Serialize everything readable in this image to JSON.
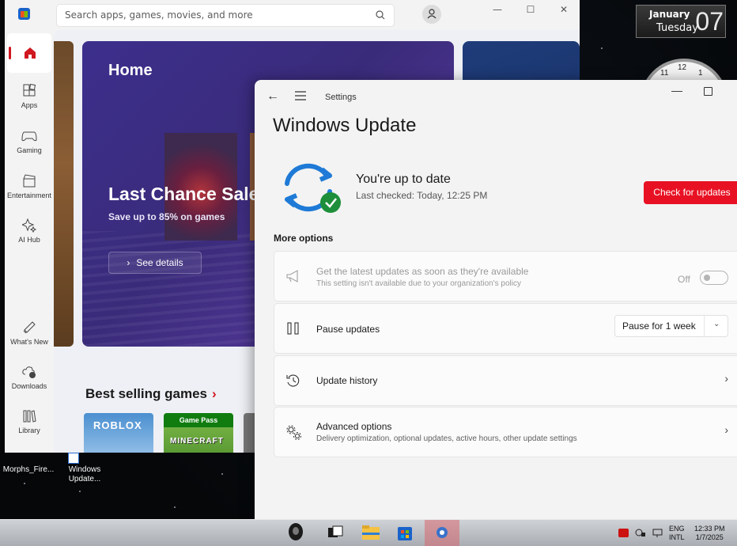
{
  "store": {
    "search_placeholder": "Search apps, games, movies, and more",
    "rail": [
      {
        "label": ""
      },
      {
        "label": "Apps"
      },
      {
        "label": "Gaming"
      },
      {
        "label": "Entertainment"
      },
      {
        "label": "AI Hub"
      },
      {
        "label": "What's New"
      },
      {
        "label": "Downloads"
      },
      {
        "label": "Library"
      }
    ],
    "hero": {
      "title": "Home",
      "headline": "Last Chance Sale",
      "subtitle": "Save up to 85% on games",
      "button": "See details"
    },
    "best_selling": "Best selling games",
    "tiles": [
      {
        "title": "ROBLOX"
      },
      {
        "badge": "Game Pass",
        "title": "MINECRAFT"
      }
    ]
  },
  "settings": {
    "app_title": "Settings",
    "page_title": "Windows Update",
    "status_title": "You're up to date",
    "status_sub": "Last checked: Today, 12:25 PM",
    "check_button": "Check for updates",
    "more_options": "More options",
    "options": [
      {
        "label": "Get the latest updates as soon as they're available",
        "desc": "This setting isn't available due to your organization's policy",
        "toggle_text": "Off",
        "toggle_on": false,
        "disabled": true
      },
      {
        "label": "Pause updates",
        "select_value": "Pause for 1 week"
      },
      {
        "label": "Update history"
      },
      {
        "label": "Advanced options",
        "desc": "Delivery optimization, optional updates, active hours, other update settings"
      }
    ],
    "accent_color": "#e81123"
  },
  "desktop": {
    "date_month": "January",
    "date_weekday": "Tuesday",
    "date_day": "07",
    "clock_numbers": [
      "11",
      "12",
      "1"
    ],
    "icons": [
      {
        "label": "Morphs_Fire..."
      },
      {
        "label": "Windows Update..."
      }
    ]
  },
  "taskbar": {
    "lang_top": "ENG",
    "lang_bottom": "INTL",
    "time": "12:33 PM",
    "date": "1/7/2025"
  }
}
